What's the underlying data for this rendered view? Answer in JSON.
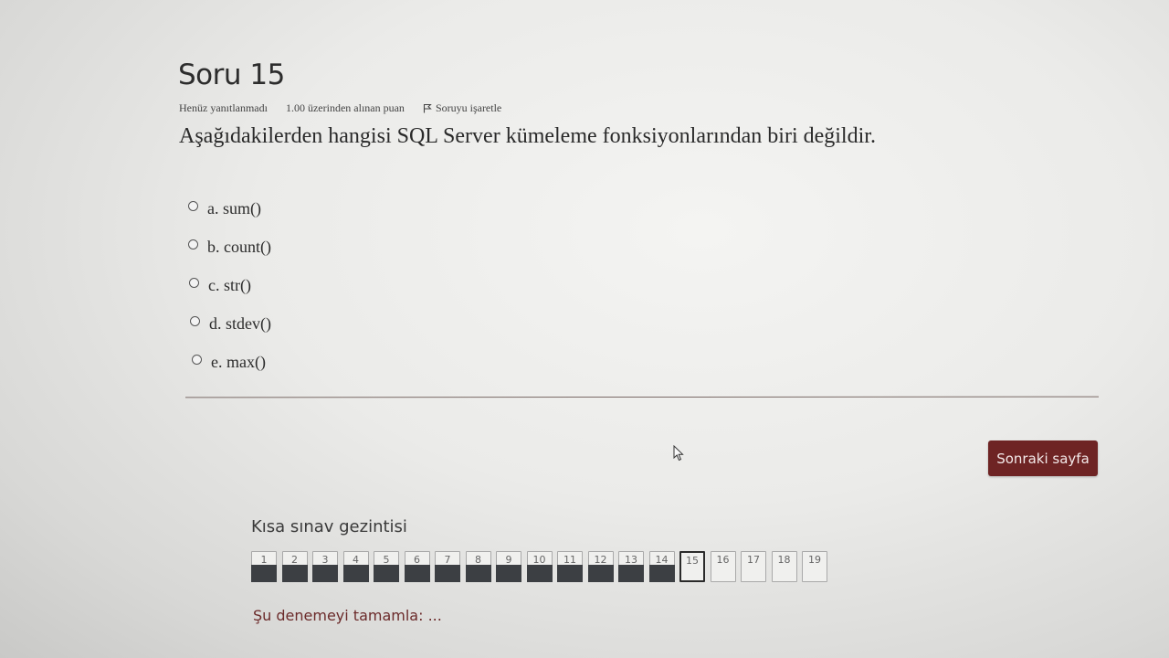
{
  "question": {
    "title": "Soru 15",
    "status": "Henüz yanıtlanmadı",
    "points": "1.00 üzerinden alınan puan",
    "flag_label": "Soruyu işaretle",
    "text": "Aşağıdakilerden hangisi SQL Server kümeleme fonksiyonlarından biri değildir.",
    "answers": [
      {
        "label": "a. sum()"
      },
      {
        "label": "b. count()"
      },
      {
        "label": "c. str()"
      },
      {
        "label": "d. stdev()"
      },
      {
        "label": "e. max()"
      }
    ]
  },
  "next_button": "Sonraki sayfa",
  "navigation": {
    "title": "Kısa sınav gezintisi",
    "current": "15",
    "buttons": [
      {
        "num": "1",
        "state": "answered"
      },
      {
        "num": "2",
        "state": "answered"
      },
      {
        "num": "3",
        "state": "answered"
      },
      {
        "num": "4",
        "state": "answered"
      },
      {
        "num": "5",
        "state": "answered"
      },
      {
        "num": "6",
        "state": "answered"
      },
      {
        "num": "7",
        "state": "answered"
      },
      {
        "num": "8",
        "state": "answered"
      },
      {
        "num": "9",
        "state": "answered"
      },
      {
        "num": "10",
        "state": "answered"
      },
      {
        "num": "11",
        "state": "answered"
      },
      {
        "num": "12",
        "state": "answered"
      },
      {
        "num": "13",
        "state": "answered"
      },
      {
        "num": "14",
        "state": "answered"
      },
      {
        "num": "15",
        "state": "current"
      },
      {
        "num": "16",
        "state": "empty"
      },
      {
        "num": "17",
        "state": "empty"
      },
      {
        "num": "18",
        "state": "empty"
      },
      {
        "num": "19",
        "state": "empty"
      }
    ],
    "finish_link": "Şu denemeyi tamamla: ..."
  },
  "colors": {
    "accent": "#6e2424",
    "answered_fill": "#3c3f43"
  },
  "icons": {
    "flag": "flag-icon",
    "cursor": "mouse-pointer-icon",
    "radio": "radio-icon"
  }
}
